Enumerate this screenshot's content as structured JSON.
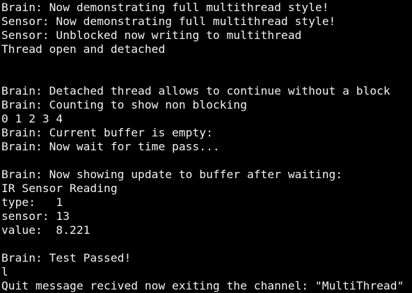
{
  "terminal": {
    "background": "#000000",
    "foreground": "#f2f2f2",
    "lines": [
      "Brain: Now demonstrating full multithread style!",
      "Sensor: Now demonstrating full multithread style!",
      "Sensor: Unblocked now writing to multithread",
      "Thread open and detached",
      "",
      "",
      "Brain: Detached thread allows to continue without a block",
      "Brain: Counting to show non blocking",
      "0 1 2 3 4",
      "Brain: Current buffer is empty:",
      "Brain: Now wait for time pass...",
      "",
      "Brain: Now showing update to buffer after waiting:",
      "IR Sensor Reading",
      "type:   1",
      "sensor: 13",
      "value:  8.221",
      "",
      "Brain: Test Passed!",
      "l",
      "Quit message recived now exiting the channel: \"MultiThread\""
    ]
  }
}
